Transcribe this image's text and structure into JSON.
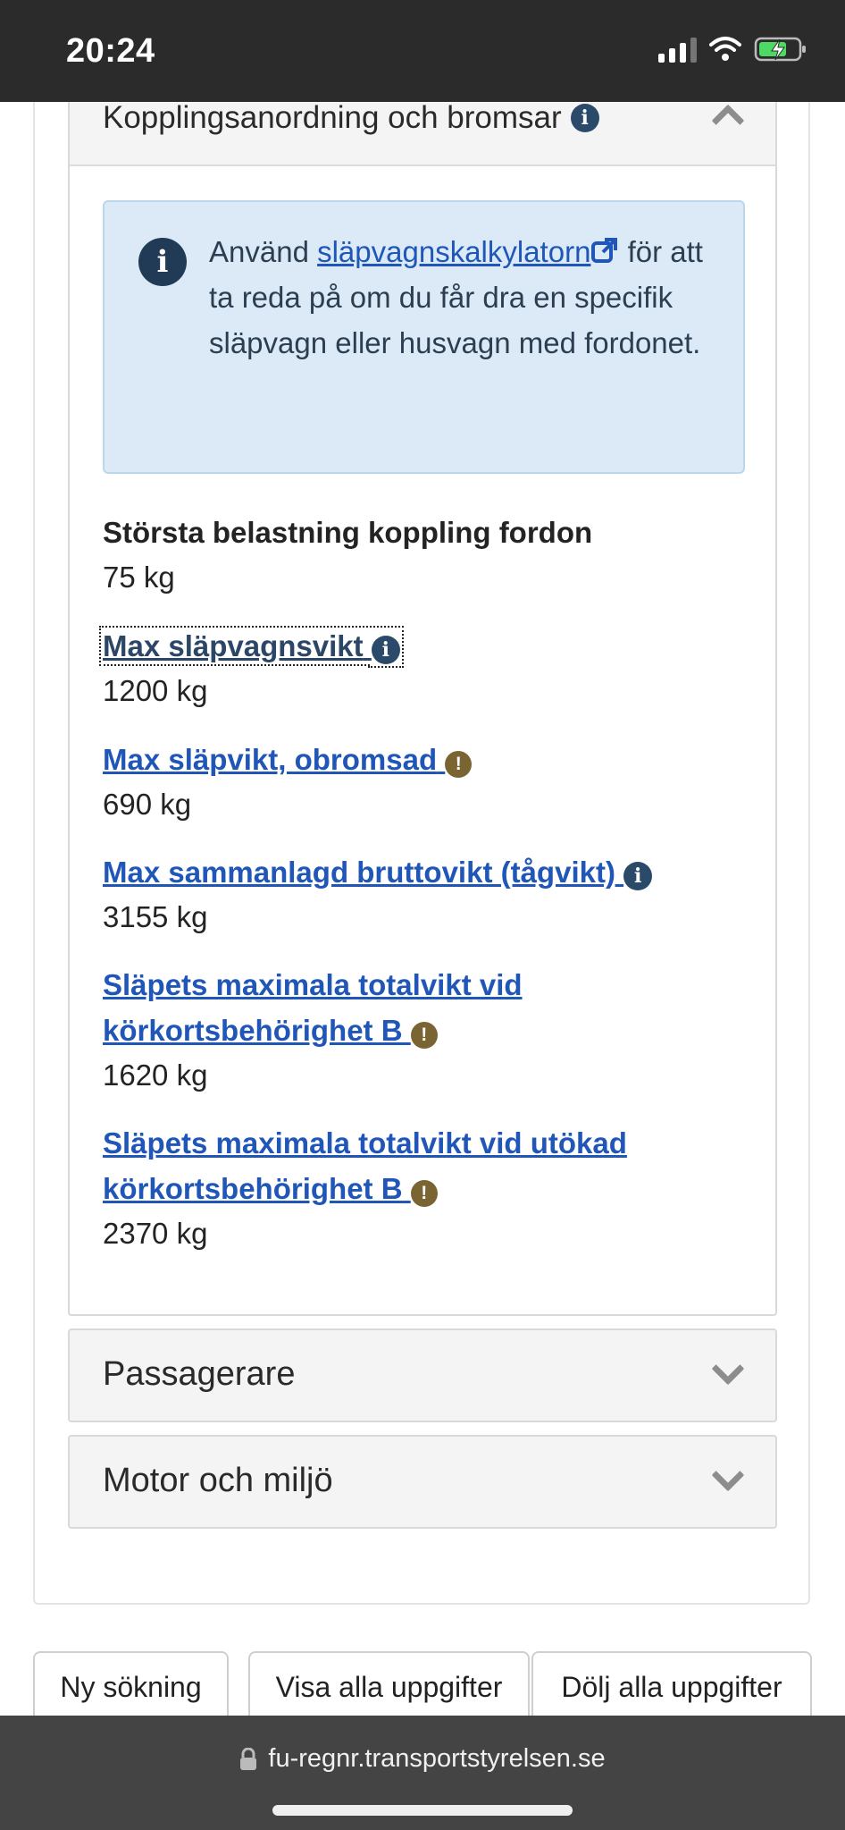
{
  "status_bar": {
    "time": "20:24"
  },
  "section_open": {
    "title": "Kopplingsanordning och bromsar",
    "info": {
      "prefix": "Använd ",
      "link_text": "släpvagnskalkylatorn",
      "suffix": " för att ta reda på om du får dra en specifik släpvagn eller husvagn med fordonet."
    },
    "fields": [
      {
        "label": "Största belastning koppling fordon",
        "value": "75 kg"
      },
      {
        "label": "Max släpvagnsvikt",
        "value": "1200 kg"
      },
      {
        "label": "Max släpvikt, obromsad",
        "value": "690 kg"
      },
      {
        "label": "Max sammanlagd bruttovikt (tågvikt)",
        "value": "3155 kg"
      },
      {
        "label": "Släpets maximala totalvikt vid körkortsbehörighet B",
        "value": "1620 kg"
      },
      {
        "label": "Släpets maximala totalvikt vid utökad körkortsbehörighet B",
        "value": "2370 kg"
      }
    ]
  },
  "sections_collapsed": [
    {
      "title": "Passagerare"
    },
    {
      "title": "Motor och miljö"
    }
  ],
  "buttons": {
    "new_search": "Ny sökning",
    "show_all": "Visa alla uppgifter",
    "hide_all": "Dölj alla uppgifter"
  },
  "url_bar": {
    "url": "fu-regnr.transportstyrelsen.se"
  },
  "icons": {
    "info": "info-circle-icon",
    "warning": "exclamation-circle-icon",
    "external": "external-link-icon",
    "chevron_up": "chevron-up-icon",
    "chevron_down": "chevron-down-icon",
    "lock": "lock-icon"
  },
  "colors": {
    "link": "#1f56b8",
    "info_bg": "#dbeaf6",
    "info_icon": "#2b4a6a",
    "warning_icon": "#7a6431"
  }
}
